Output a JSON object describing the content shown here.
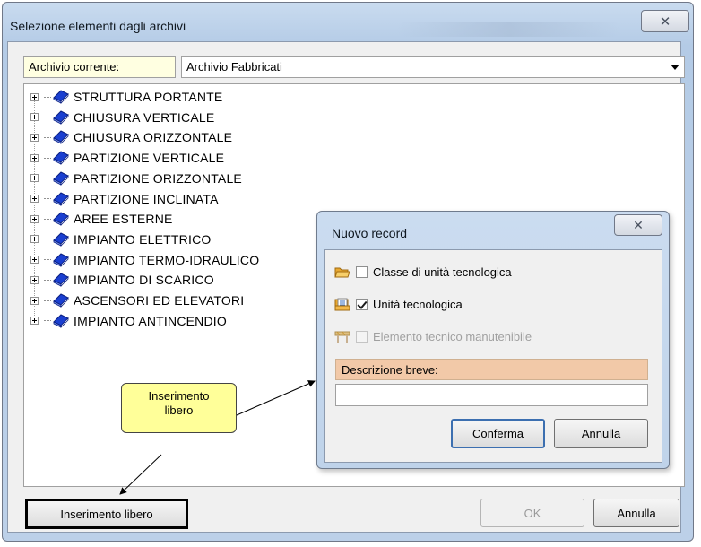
{
  "window": {
    "title": "Selezione elementi dagli archivi",
    "close_glyph": "✕"
  },
  "archive": {
    "label": "Archivio corrente:",
    "value": "Archivio Fabbricati"
  },
  "tree": {
    "items": [
      {
        "label": "STRUTTURA PORTANTE"
      },
      {
        "label": "CHIUSURA VERTICALE"
      },
      {
        "label": "CHIUSURA ORIZZONTALE"
      },
      {
        "label": "PARTIZIONE VERTICALE"
      },
      {
        "label": "PARTIZIONE ORIZZONTALE"
      },
      {
        "label": "PARTIZIONE INCLINATA"
      },
      {
        "label": "AREE ESTERNE"
      },
      {
        "label": "IMPIANTO ELETTRICO"
      },
      {
        "label": "IMPIANTO TERMO-IDRAULICO"
      },
      {
        "label": "IMPIANTO DI SCARICO"
      },
      {
        "label": "ASCENSORI ED ELEVATORI"
      },
      {
        "label": "IMPIANTO ANTINCENDIO"
      }
    ],
    "icon": "blue-book-icon",
    "icon_color": "#1a3fd0"
  },
  "callout": {
    "line1": "Inserimento",
    "line2": "libero"
  },
  "buttons": {
    "insert_free": "Inserimento libero",
    "ok": "OK",
    "cancel": "Annulla"
  },
  "dialog": {
    "title": "Nuovo record",
    "close_glyph": "✕",
    "options": {
      "class_label": "Classe di unità tecnologica",
      "unit_label": "Unità tecnologica",
      "element_label": "Elemento tecnico manutenibile"
    },
    "description_label": "Descrizione breve:",
    "description_value": "",
    "confirm": "Conferma",
    "cancel": "Annulla"
  },
  "colors": {
    "title_bar": "#bcd0e8",
    "tooltip": "#ffffe1",
    "callout": "#ffff99",
    "desc_label": "#f2c9a8"
  }
}
